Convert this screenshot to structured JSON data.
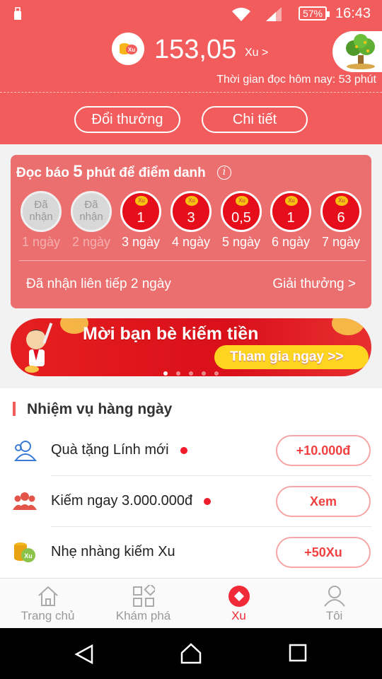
{
  "status_bar": {
    "battery": "57%",
    "time": "16:43"
  },
  "header": {
    "balance": "153,05",
    "balance_unit": "Xu >",
    "coin_icon_text": "Xu",
    "read_time": "Thời gian đọc hôm nay: 53 phút",
    "redeem_label": "Đổi thưởng",
    "details_label": "Chi tiết"
  },
  "checkin": {
    "title_prefix": "Đọc báo",
    "title_number": "5",
    "title_suffix": "phút để điểm danh",
    "days": [
      {
        "state": "done",
        "text": "Đã nhận",
        "label": "1 ngày"
      },
      {
        "state": "done",
        "text": "Đã nhận",
        "label": "2 ngày"
      },
      {
        "state": "todo",
        "text": "1",
        "label": "3 ngày"
      },
      {
        "state": "todo",
        "text": "3",
        "label": "4 ngày"
      },
      {
        "state": "todo",
        "text": "0,5",
        "label": "5 ngày"
      },
      {
        "state": "todo",
        "text": "1",
        "label": "6 ngày"
      },
      {
        "state": "todo",
        "text": "6",
        "label": "7 ngày"
      }
    ],
    "mini_coin_text": "Xu",
    "streak_text": "Đã nhận liên tiếp 2 ngày",
    "reward_link": "Giải thưởng >"
  },
  "banner": {
    "title": "Mời bạn bè kiếm tiền",
    "button": "Tham gia ngay >>",
    "slide_count": 5,
    "active_slide": 1
  },
  "tasks": {
    "title": "Nhiệm vụ hàng ngày",
    "items": [
      {
        "icon": "new-user-icon",
        "label": "Quà tặng Lính mới",
        "dot": true,
        "action": "+10.000đ"
      },
      {
        "icon": "group-icon",
        "label": "Kiếm ngay 3.000.000đ",
        "dot": true,
        "action": "Xem"
      },
      {
        "icon": "coins-icon",
        "label": "Nhẹ nhàng kiếm Xu",
        "dot": false,
        "action": "+50Xu"
      }
    ]
  },
  "bottom_nav": {
    "items": [
      {
        "label": "Trang chủ",
        "icon": "home-icon"
      },
      {
        "label": "Khám phá",
        "icon": "explore-icon"
      },
      {
        "label": "Xu",
        "icon": "xu-icon",
        "active": true
      },
      {
        "label": "Tôi",
        "icon": "profile-icon"
      }
    ]
  },
  "colors": {
    "primary": "#f25c5c",
    "accent_red": "#e60e1a",
    "yellow": "#fdd520"
  }
}
